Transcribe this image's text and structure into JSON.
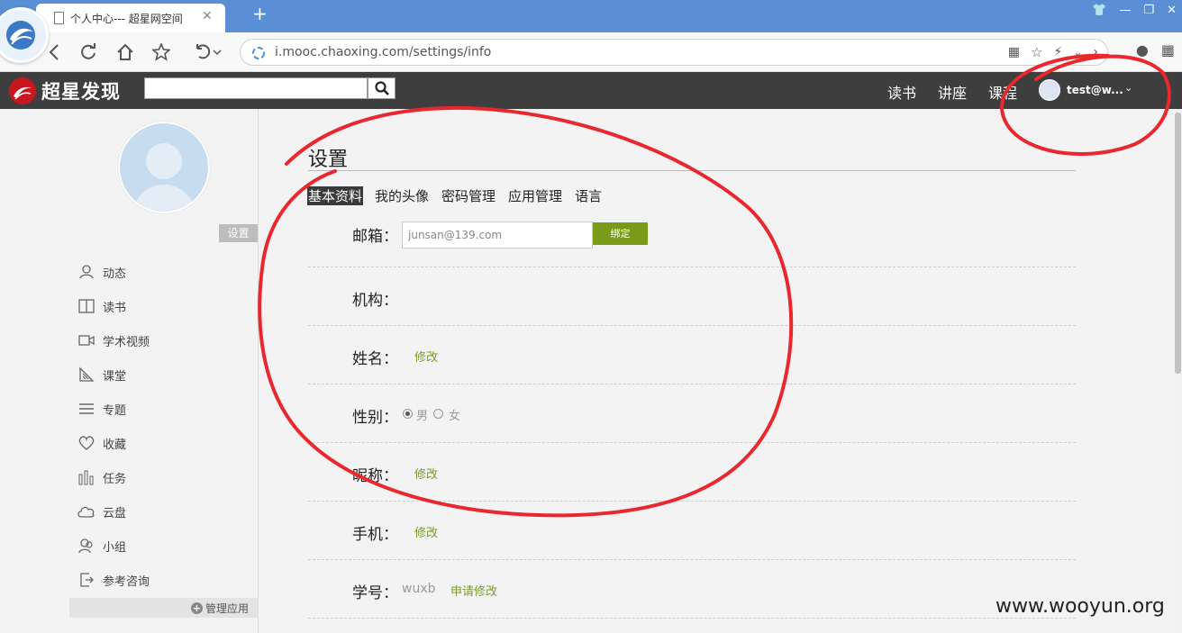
{
  "browser": {
    "tab_title": "个人中心--- 超星网空间",
    "url": "i.mooc.chaoxing.com/settings/info"
  },
  "site": {
    "logo_text": "超星发现",
    "nav": [
      "读书",
      "讲座",
      "课程"
    ],
    "user": "test@w..."
  },
  "sidebar": {
    "settings_label": "设置",
    "items": [
      {
        "label": "动态",
        "icon": "user-icon"
      },
      {
        "label": "读书",
        "icon": "book-icon"
      },
      {
        "label": "学术视频",
        "icon": "video-icon"
      },
      {
        "label": "课堂",
        "icon": "classroom-icon"
      },
      {
        "label": "专题",
        "icon": "topic-icon"
      },
      {
        "label": "收藏",
        "icon": "heart-icon"
      },
      {
        "label": "任务",
        "icon": "task-icon"
      },
      {
        "label": "云盘",
        "icon": "cloud-icon"
      },
      {
        "label": "小组",
        "icon": "group-icon"
      },
      {
        "label": "参考咨询",
        "icon": "consult-icon"
      }
    ],
    "manage_label": "管理应用"
  },
  "main": {
    "title": "设置",
    "tabs": [
      "基本资料",
      "我的头像",
      "密码管理",
      "应用管理",
      "语言"
    ],
    "fields": {
      "email": {
        "label": "邮箱：",
        "value": "junsan@139.com",
        "button": "绑定"
      },
      "org": {
        "label": "机构："
      },
      "name": {
        "label": "姓名：",
        "link": "修改"
      },
      "gender": {
        "label": "性别：",
        "options": [
          "男",
          "女"
        ],
        "selected": "男"
      },
      "nickname": {
        "label": "昵称：",
        "link": "修改"
      },
      "phone": {
        "label": "手机：",
        "link": "修改"
      },
      "student_id": {
        "label": "学号：",
        "value": "wuxb",
        "link": "申请修改"
      }
    }
  },
  "watermark": "www.wooyun.org",
  "colors": {
    "accent_green": "#7a9a1a",
    "header_bg": "#3e3e3e",
    "annotation_red": "#e8282e"
  }
}
